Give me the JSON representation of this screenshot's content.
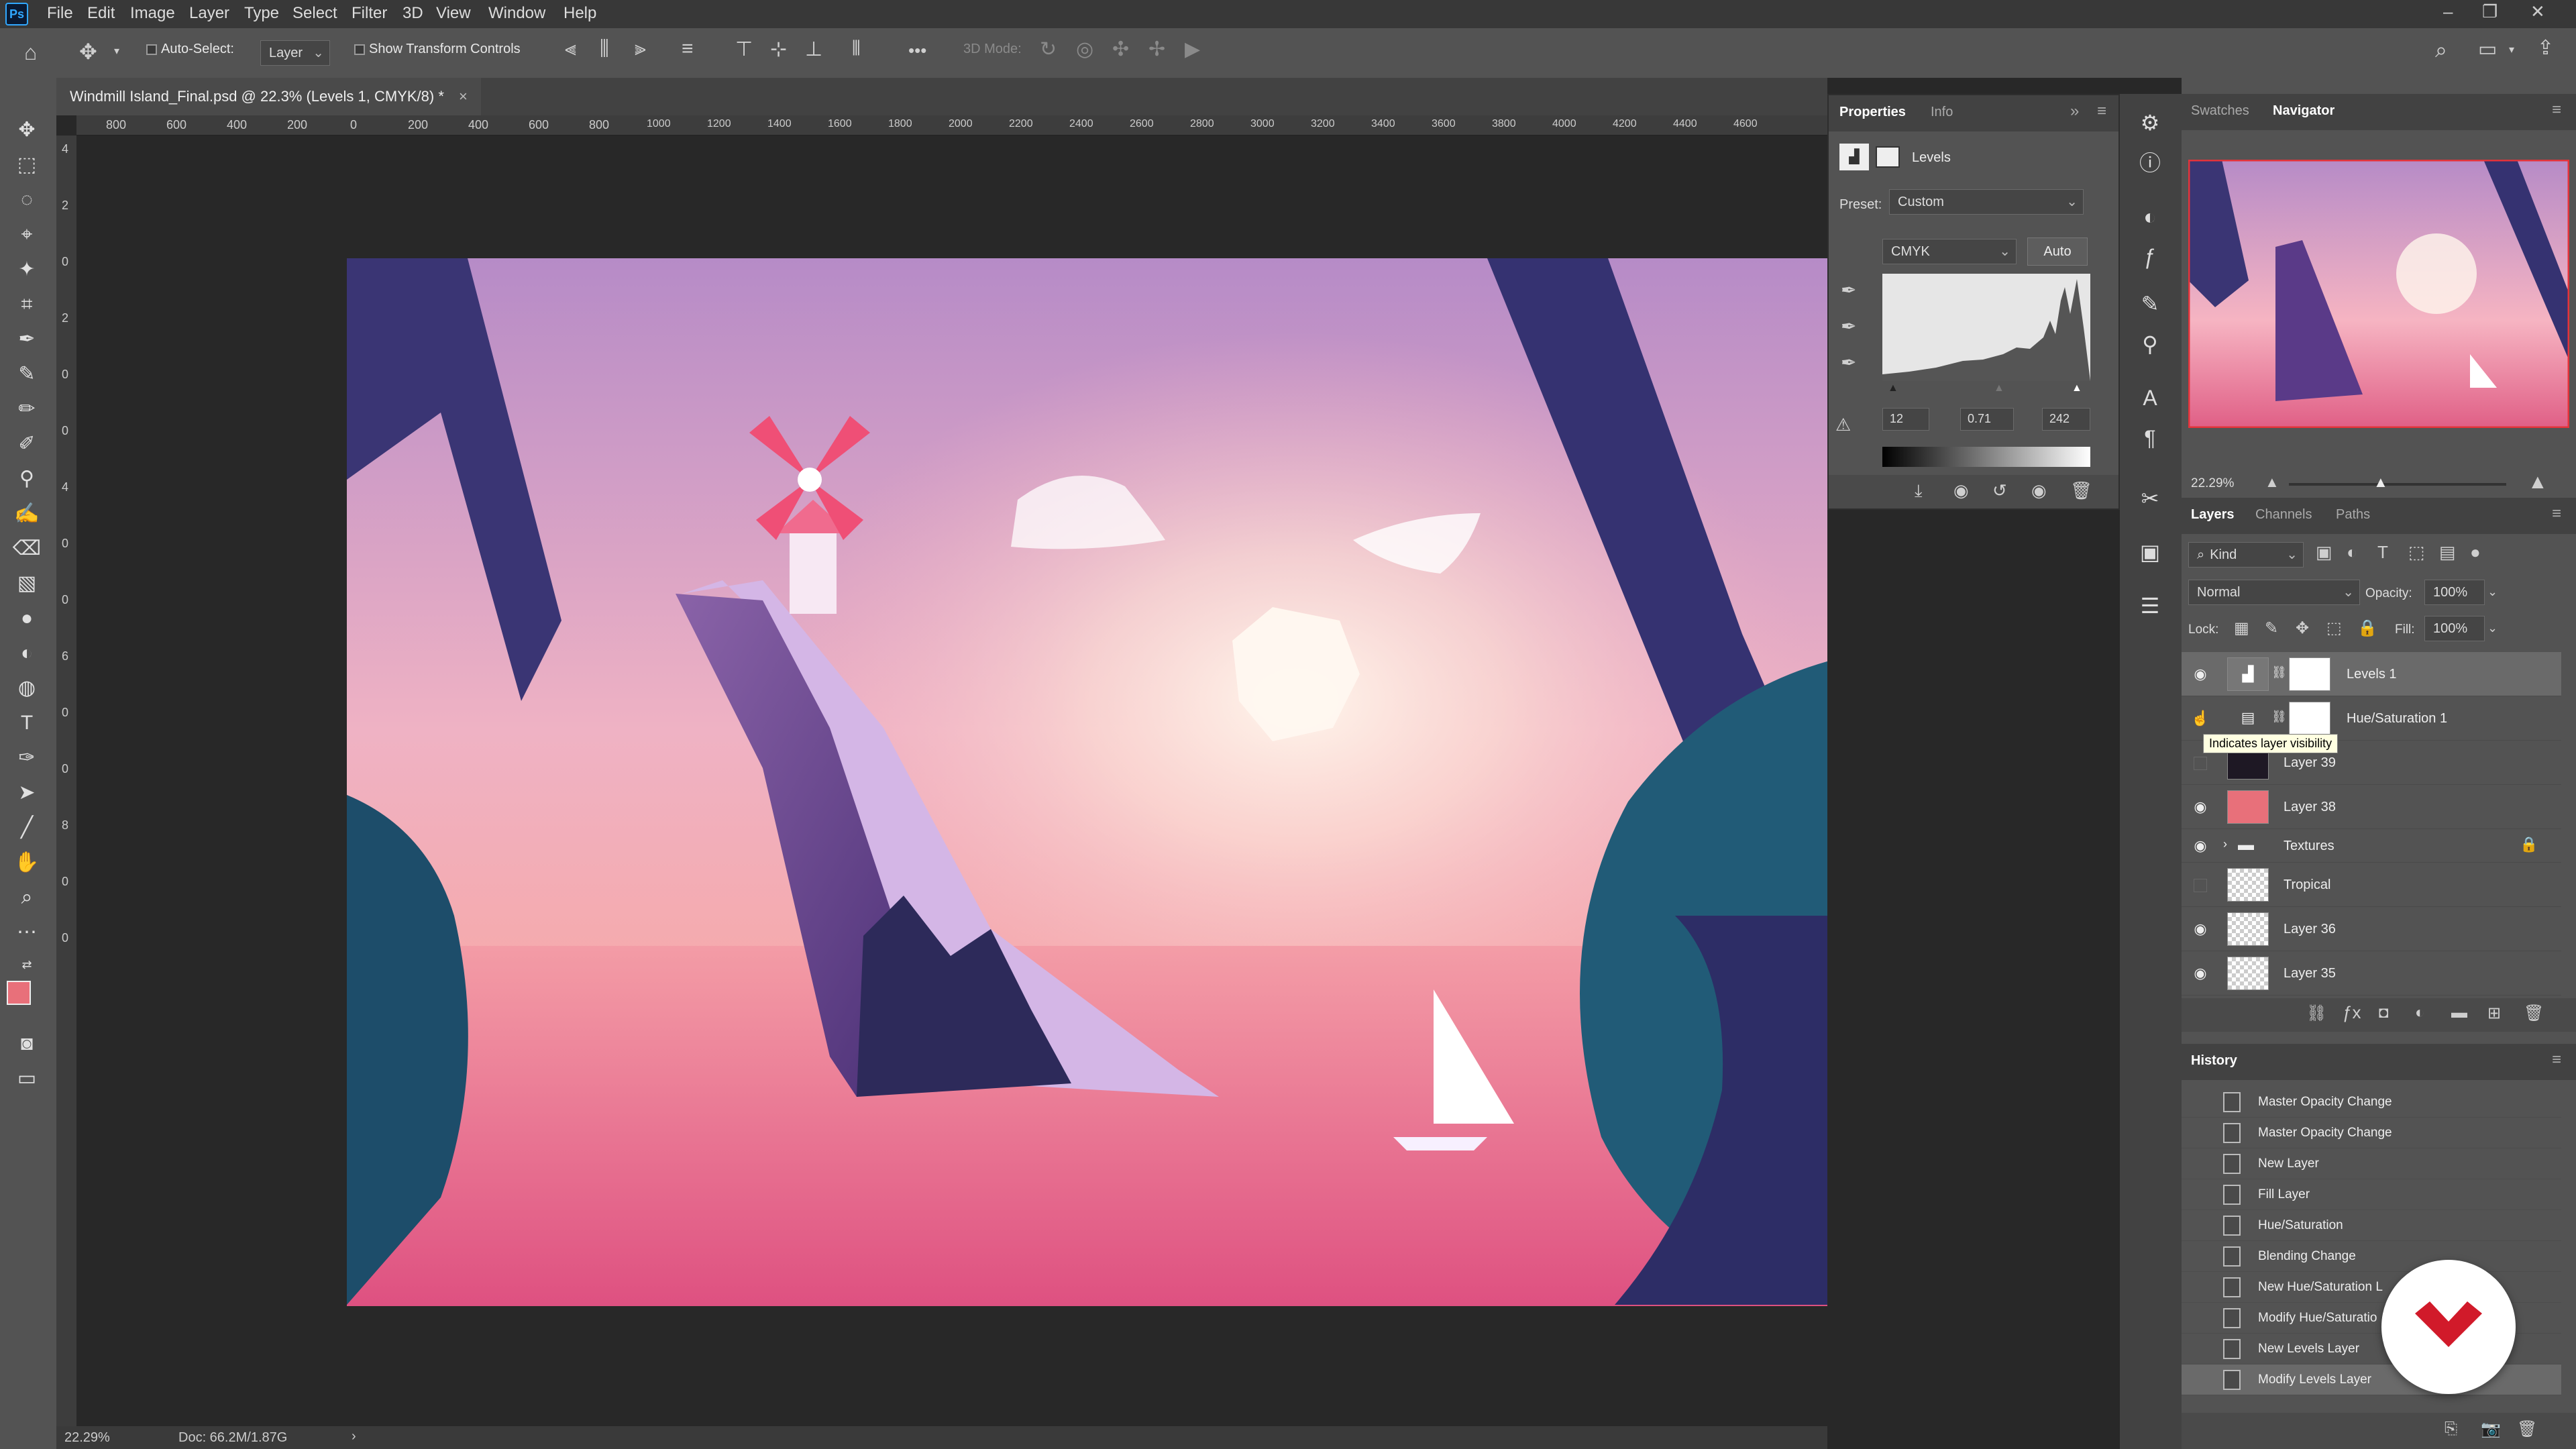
{
  "app": {
    "logo": "Ps"
  },
  "menu": [
    "File",
    "Edit",
    "Image",
    "Layer",
    "Type",
    "Select",
    "Filter",
    "3D",
    "View",
    "Window",
    "Help"
  ],
  "options_bar": {
    "auto_select_label": "Auto-Select:",
    "auto_select_target": "Layer",
    "show_transform_label": "Show Transform Controls",
    "mode_3d_label": "3D Mode:",
    "more": "•••"
  },
  "document": {
    "tab_title": "Windmill Island_Final.psd @ 22.3% (Levels 1, CMYK/8) *",
    "close": "×",
    "ruler_h": [
      "800",
      "600",
      "400",
      "200",
      "0",
      "200",
      "400",
      "600",
      "800",
      "1000",
      "1200",
      "1400",
      "1600",
      "1800",
      "2000",
      "2200",
      "2400",
      "2600",
      "2800",
      "3000",
      "3200",
      "3400",
      "3600",
      "3800",
      "4000",
      "4200",
      "4400",
      "4600"
    ],
    "ruler_v": [
      "4",
      "2",
      "0",
      "2",
      "0",
      "0",
      "4",
      "0",
      "0",
      "6",
      "0",
      "0",
      "8",
      "0",
      "0"
    ]
  },
  "status": {
    "zoom": "22.29%",
    "doc": "Doc: 66.2M/1.87G",
    "arrow": "›"
  },
  "properties": {
    "tabs": [
      "Properties",
      "Info"
    ],
    "title": "Levels",
    "preset_label": "Preset:",
    "preset_value": "Custom",
    "channel": "CMYK",
    "auto_label": "Auto",
    "input_levels": {
      "shadow": "12",
      "midtone": "0.71",
      "highlight": "242"
    },
    "collapse": "»",
    "menu": "≡"
  },
  "navigator": {
    "tabs": [
      "Swatches",
      "Navigator"
    ],
    "zoom": "22.29%"
  },
  "layers_panel": {
    "tabs": [
      "Layers",
      "Channels",
      "Paths"
    ],
    "filter_kind": "Kind",
    "blend_mode": "Normal",
    "opacity_label": "Opacity:",
    "opacity_value": "100%",
    "lock_label": "Lock:",
    "fill_label": "Fill:",
    "fill_value": "100%",
    "tooltip": "Indicates layer visibility",
    "layers": [
      {
        "name": "Levels 1",
        "visible": true
      },
      {
        "name": "Hue/Saturation 1",
        "visible": false
      },
      {
        "name": "Layer 39",
        "visible": false
      },
      {
        "name": "Layer 38",
        "visible": true
      },
      {
        "name": "Textures",
        "visible": true
      },
      {
        "name": "Tropical",
        "visible": false
      },
      {
        "name": "Layer 36",
        "visible": true
      },
      {
        "name": "Layer 35",
        "visible": true
      }
    ]
  },
  "history": {
    "title": "History",
    "items": [
      "Master Opacity Change",
      "Master Opacity Change",
      "New Layer",
      "Fill Layer",
      "Hue/Saturation",
      "Blending Change",
      "New Hue/Saturation L",
      "Modify Hue/Saturatio",
      "New Levels Layer",
      "Modify Levels Layer"
    ]
  },
  "colors": {
    "foreground": "#e8707a",
    "background": "#1a1a2e",
    "accent": "#31a8ff"
  }
}
